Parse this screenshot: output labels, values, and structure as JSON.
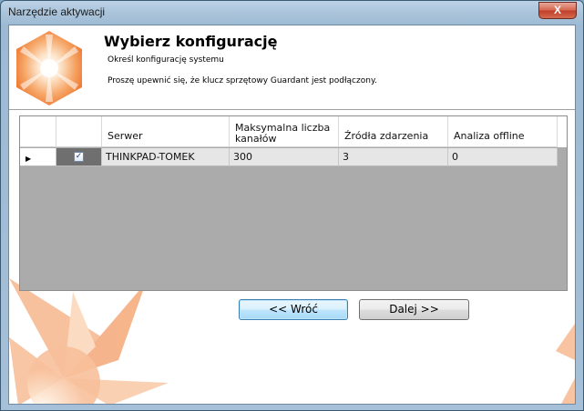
{
  "window": {
    "title": "Narzędzie aktywacji",
    "close_glyph": "X"
  },
  "header": {
    "title": "Wybierz konfigurację",
    "subtitle": "Określ konfigurację systemu",
    "note": "Proszę upewnić się, że klucz sprzętowy Guardant jest podłączony."
  },
  "grid": {
    "columns": [
      "",
      "",
      "Serwer",
      "Maksymalna liczba kanałów",
      "Źródła zdarzenia",
      "Analiza offline"
    ],
    "rows": [
      {
        "indicator": "▶",
        "checked": "✓",
        "server": "THINKPAD-TOMEK",
        "max_channels": "300",
        "event_sources": "3",
        "offline_analysis": "0"
      }
    ]
  },
  "buttons": {
    "back": "<< Wróć",
    "next": "Dalej >>"
  },
  "colors": {
    "accent": "#f08a4b",
    "grid_bg": "#ababab"
  },
  "icons": {
    "logo": "orange-star-icon",
    "close": "close-icon",
    "row_indicator": "row-pointer-icon"
  }
}
